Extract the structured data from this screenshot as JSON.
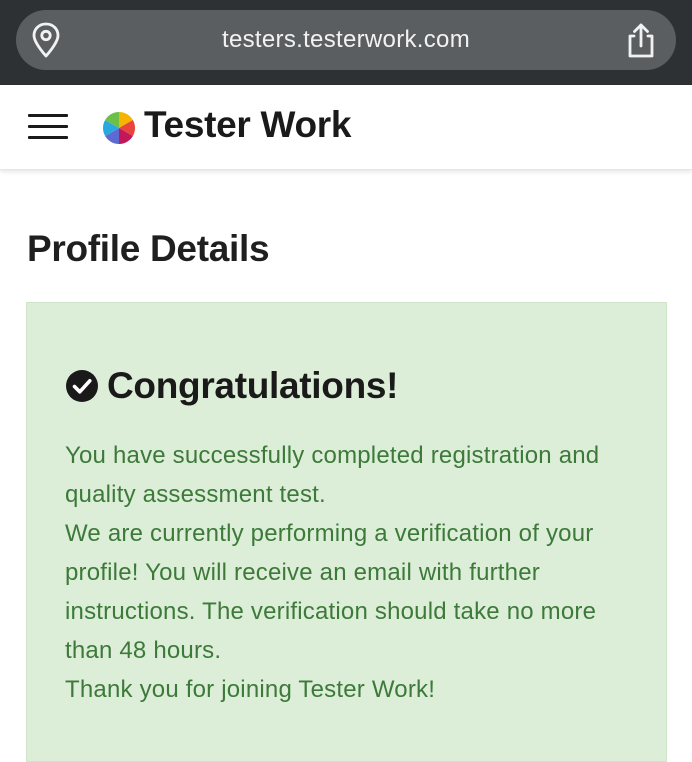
{
  "browser": {
    "url": "testers.testerwork.com",
    "left_icon": "location-pin-icon",
    "right_icon": "share-icon"
  },
  "header": {
    "menu_icon": "hamburger-menu-icon",
    "logo_icon": "color-wheel-logo-icon",
    "brand_name": "Tester Work"
  },
  "page": {
    "title": "Profile Details"
  },
  "alert": {
    "icon": "check-circle-icon",
    "title": "Congratulations!",
    "lines": [
      "You have successfully completed registration and quality assessment test.",
      "We are currently performing a verification of your profile! You will receive an email with further instructions. The verification should take no more than 48 hours.",
      "Thank you for joining Tester Work!"
    ]
  },
  "colors": {
    "chrome_bg": "#2e3133",
    "url_pill": "#5b5e61",
    "alert_bg": "#dcedd8",
    "alert_text": "#3d7a3a"
  }
}
